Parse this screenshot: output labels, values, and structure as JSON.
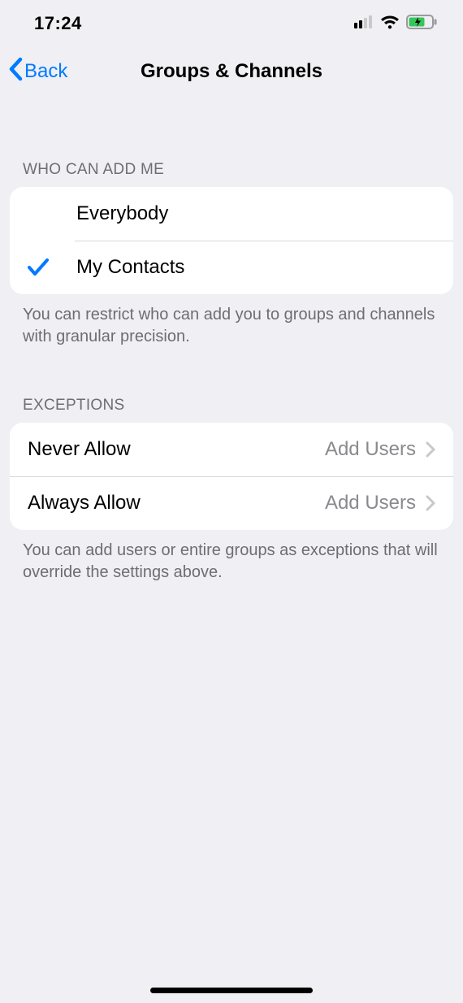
{
  "status_bar": {
    "time": "17:24"
  },
  "nav": {
    "back_label": "Back",
    "title": "Groups & Channels"
  },
  "section_who": {
    "header": "WHO CAN ADD ME",
    "options": {
      "everybody": "Everybody",
      "my_contacts": "My Contacts"
    },
    "selected": "my_contacts",
    "footer": "You can restrict who can add you to groups and channels with granular precision."
  },
  "section_exceptions": {
    "header": "EXCEPTIONS",
    "rows": {
      "never": {
        "label": "Never Allow",
        "detail": "Add Users"
      },
      "always": {
        "label": "Always Allow",
        "detail": "Add Users"
      }
    },
    "footer": "You can add users or entire groups as exceptions that will override the settings above."
  }
}
